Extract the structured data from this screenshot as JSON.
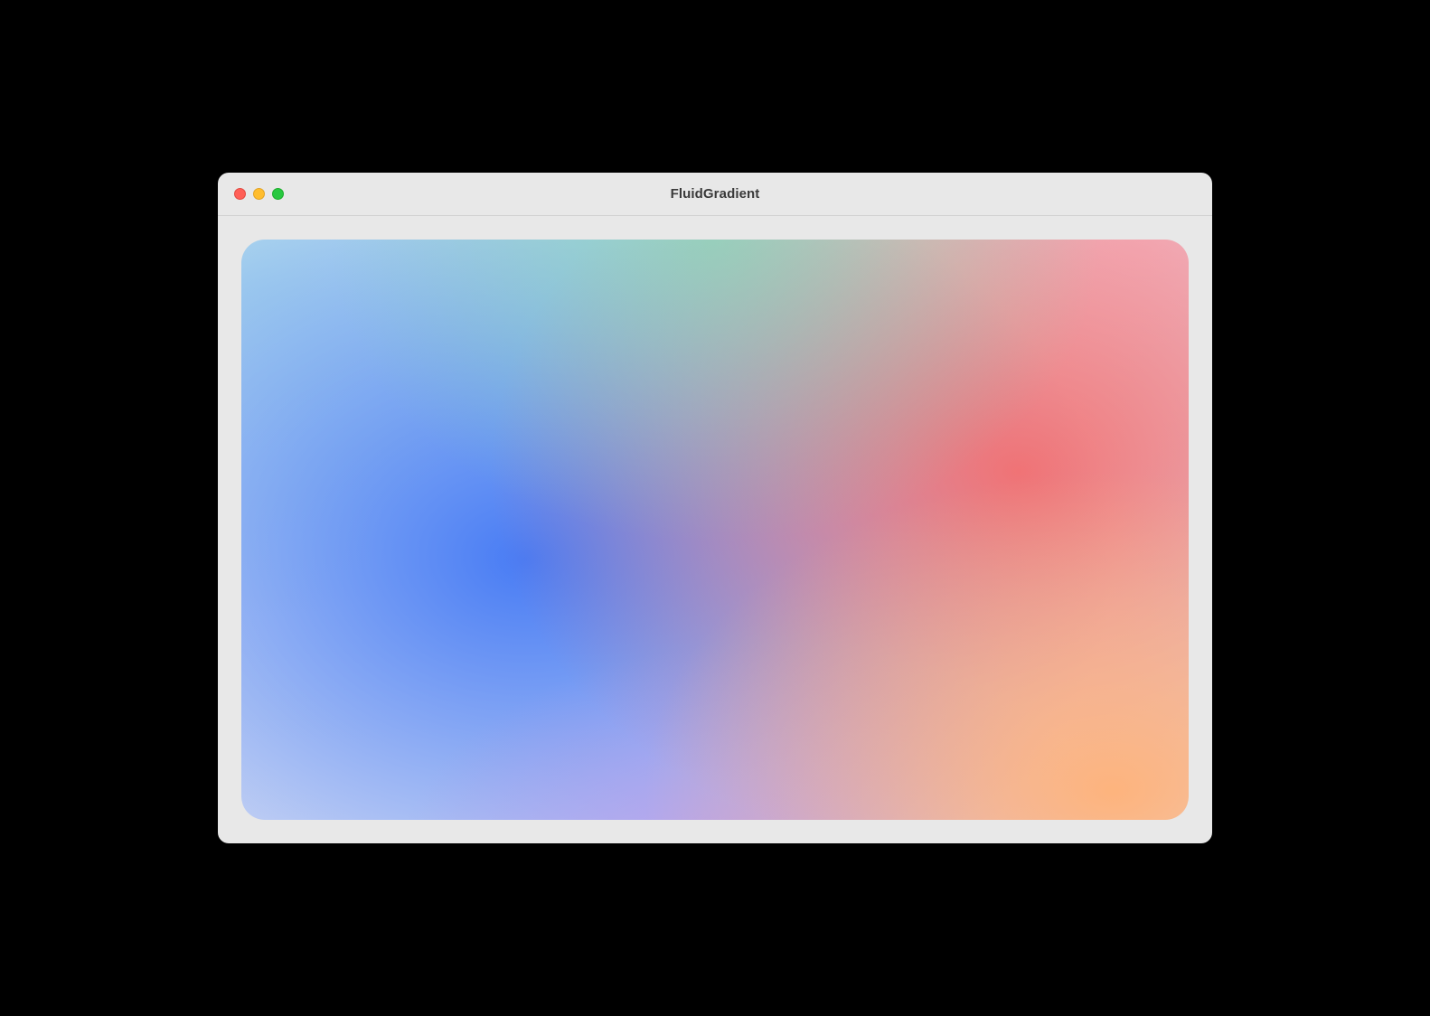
{
  "window": {
    "title": "FluidGradient"
  },
  "traffic_lights": {
    "close": "close-icon",
    "minimize": "minimize-icon",
    "zoom": "zoom-icon"
  },
  "gradient": {
    "blobs": [
      {
        "name": "top-mint",
        "color": "#86d6b0",
        "cx": 0.5,
        "cy": 0.0
      },
      {
        "name": "bottom-right-orange",
        "color": "#ffb278",
        "cx": 0.92,
        "cy": 0.95
      },
      {
        "name": "right-red",
        "color": "#f46969",
        "cx": 0.82,
        "cy": 0.4
      },
      {
        "name": "bottom-center-violet",
        "color": "#ba95e8",
        "cx": 0.55,
        "cy": 1.08
      },
      {
        "name": "center-left-blue",
        "color": "#4076f5",
        "cx": 0.3,
        "cy": 0.55
      },
      {
        "name": "top-left-pale-cyan",
        "color": "#aedaec",
        "cx": 0.0,
        "cy": 0.08
      },
      {
        "name": "top-right-pink",
        "color": "#f6bdcd",
        "cx": 0.95,
        "cy": 0.0
      }
    ],
    "base_gradient": [
      "#cfe6ef",
      "#dfe4f3"
    ]
  },
  "colors": {
    "window_chrome": "#e8e8e8",
    "titlebar_divider": "#d1d1d1",
    "title_text": "#3a3a3a",
    "traffic_light_red": "#ff5f57",
    "traffic_light_yellow": "#ffbd2e",
    "traffic_light_green": "#28c840",
    "desktop_background": "#000000"
  }
}
